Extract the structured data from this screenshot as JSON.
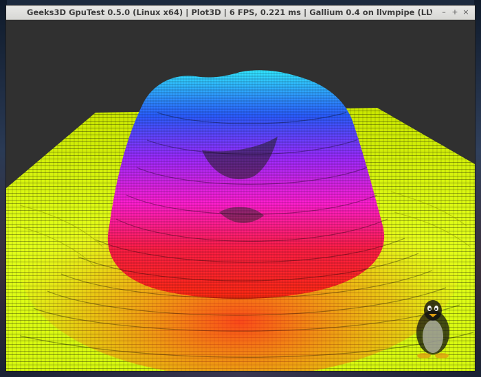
{
  "window": {
    "title": "Geeks3D GpuTest 0.5.0 (Linux x64) | Plot3D | 6 FPS, 0.221 ms | Gallium 0.4 on llvmpipe (LLV",
    "controls": {
      "minimize": "–",
      "maximize": "+",
      "close": "×"
    }
  },
  "viewport": {
    "background": "#303030",
    "surface_colors": {
      "low": "#e6ff1a",
      "mid_low": "#ff2a2a",
      "mid": "#ff1fd2",
      "mid_high": "#8a2bff",
      "high": "#2a6bff",
      "peak": "#2ae8ff"
    },
    "logo": "tux-penguin-icon"
  },
  "colors": {
    "titlebar_bg": "#dcdcda",
    "title_text": "#3c3c3c"
  }
}
